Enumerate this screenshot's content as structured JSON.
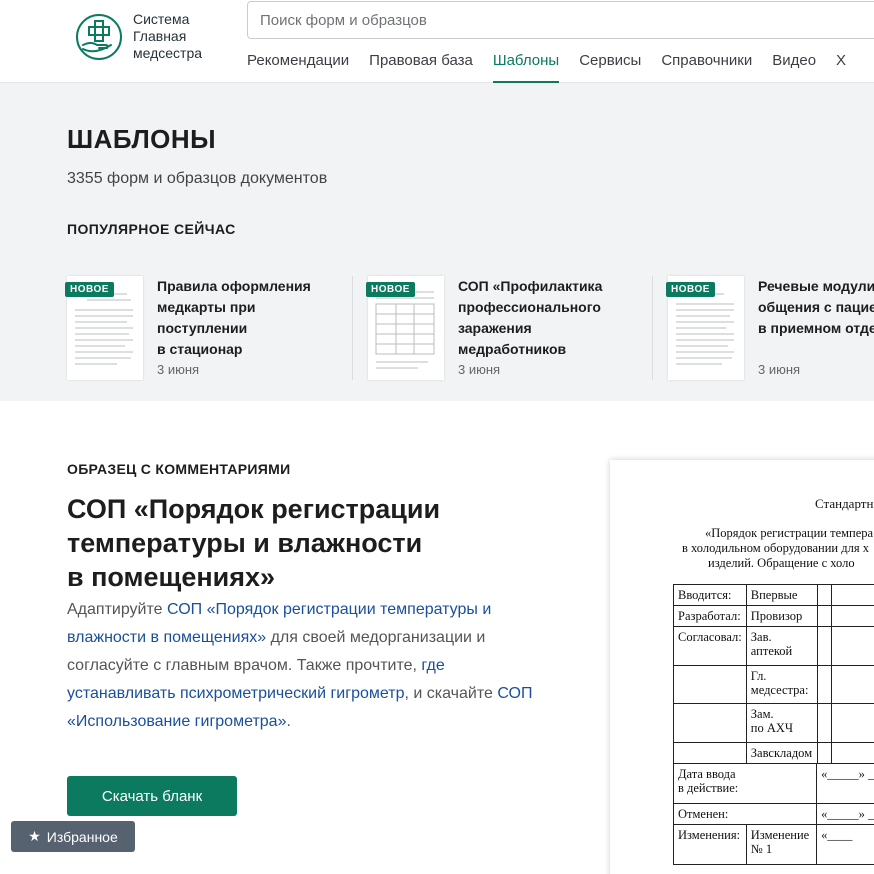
{
  "header": {
    "logo_lines": [
      "Система",
      "Главная",
      "медсестра"
    ],
    "search_placeholder": "Поиск форм и образцов",
    "nav": [
      "Рекомендации",
      "Правовая база",
      "Шаблоны",
      "Сервисы",
      "Справочники",
      "Видео",
      "Х"
    ],
    "active_nav": "Шаблоны"
  },
  "hero": {
    "title": "ШАБЛОНЫ",
    "subtitle": "3355 форм и образцов документов",
    "popular_label": "ПОПУЛЯРНОЕ СЕЙЧАС"
  },
  "popular": [
    {
      "badge": "НОВОЕ",
      "title_lines": [
        "Правила оформления",
        "медкарты при",
        "поступлении",
        "в стационар"
      ],
      "date": "3 июня"
    },
    {
      "badge": "НОВОЕ",
      "title_lines": [
        "СОП «Профилактика",
        "профессионального",
        "заражения",
        "медработников"
      ],
      "date": "3 июня"
    },
    {
      "badge": "НОВОЕ",
      "title_lines": [
        "Речевые модули",
        "общения с пацие",
        "в приемном отде"
      ],
      "date": "3 июня"
    }
  ],
  "main": {
    "eyebrow": "ОБРАЗЕЦ С КОММЕНТАРИЯМИ",
    "title_lines": [
      "СОП «Порядок регистрации",
      "температуры и влажности",
      "в помещениях»"
    ],
    "desc": {
      "t1": "Адаптируйте ",
      "link1": "СОП «Порядок регистрации температуры и влажности в помещениях»",
      "t2": " для своей медорганизации и согласуйте с главным врачом. Также прочтите, ",
      "link2": "где устанавливать психрометрический гигрометр",
      "t3": ", и скачайте ",
      "link3": "СОП «Использование гигрометра»",
      "t4": "."
    },
    "download_label": "Скачать бланк",
    "favorites_label": "Избранное"
  },
  "doc": {
    "heading": "Стандартн",
    "sub_lines": [
      "«Порядок регистрации темпера",
      "в холодильном оборудовании для х",
      "изделий. Обращение с холо"
    ],
    "rows": [
      [
        "Вводится:",
        "Впервые"
      ],
      [
        "Разработал:",
        "Провизор"
      ],
      [
        "Согласовал:",
        "Зав.\nаптекой"
      ],
      [
        "",
        "Гл.\nмедсестра:"
      ],
      [
        "",
        "Зам.\nпо АХЧ"
      ],
      [
        "",
        "Завскладом"
      ],
      [
        "Дата ввода\nв действие:",
        "«_____» ___"
      ],
      [
        "Отменен:",
        "«_____» ___"
      ],
      [
        "Изменения:",
        "Изменение\n№ 1",
        "«____"
      ]
    ]
  },
  "colors": {
    "accent": "#0b7a5e",
    "link": "#1a4f9c",
    "band": "#f1f3f5",
    "fav": "#566270"
  }
}
